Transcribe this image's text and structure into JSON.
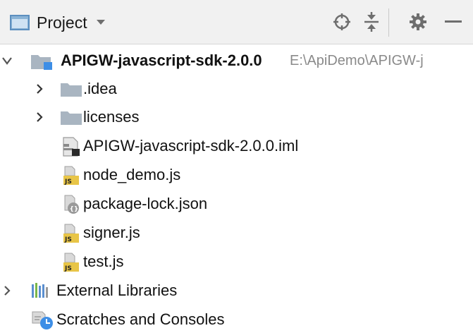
{
  "header": {
    "title": "Project",
    "icons": [
      "folder-window-icon",
      "chevron-down-icon",
      "locate-icon",
      "collapse-all-icon",
      "gear-icon",
      "minimize-icon"
    ]
  },
  "tree": {
    "root": {
      "name": "APIGW-javascript-sdk-2.0.0",
      "path": "E:\\ApiDemo\\APIGW-j",
      "expanded": true
    },
    "items": [
      {
        "name": ".idea",
        "type": "folder",
        "expanded": false
      },
      {
        "name": "licenses",
        "type": "folder",
        "expanded": false
      },
      {
        "name": "APIGW-javascript-sdk-2.0.0.iml",
        "type": "iml-file"
      },
      {
        "name": "node_demo.js",
        "type": "js-file"
      },
      {
        "name": "package-lock.json",
        "type": "json-file"
      },
      {
        "name": "signer.js",
        "type": "js-file"
      },
      {
        "name": "test.js",
        "type": "js-file"
      }
    ],
    "external_libraries": "External Libraries",
    "scratches": "Scratches and Consoles"
  },
  "colors": {
    "header_bg": "#f1f1f1",
    "icon_gray": "#6e6e6e",
    "folder_gray": "#a9b5c1",
    "module_blue": "#3d8ee6",
    "js_yellow": "#e8c547",
    "path_gray": "#8a8a8a"
  }
}
